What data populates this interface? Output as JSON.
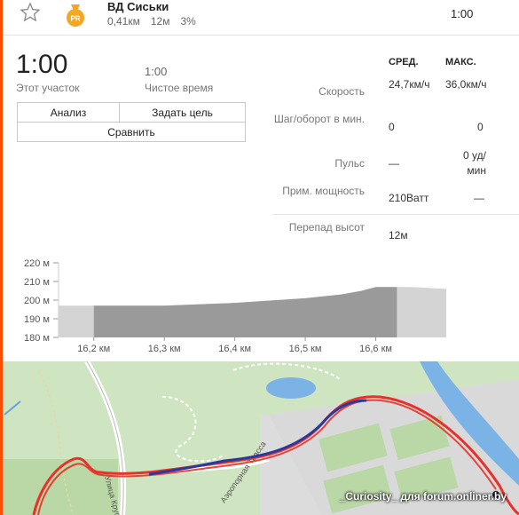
{
  "segment": {
    "name": "ВД Сиськи",
    "distance": "0,41км",
    "elev_gain": "12м",
    "grade": "3%",
    "time": "1:00"
  },
  "summary": {
    "time": "1:00",
    "time_label": "Этот участок",
    "clean_time": "1:00",
    "clean_label": "Чистое время"
  },
  "buttons": {
    "analysis": "Анализ",
    "set_goal": "Задать цель",
    "compare": "Сравнить"
  },
  "stats": {
    "col_avg": "СРЕД.",
    "col_max": "МАКС.",
    "rows": [
      {
        "label": "Скорость",
        "avg": "24,7км/ч",
        "max": "36,0км/ч"
      },
      {
        "label": "Шаг/оборот в мин.",
        "avg": "0",
        "max": "0"
      },
      {
        "label": "Пульс",
        "avg": "—",
        "max": "0 уд/мин"
      },
      {
        "label": "Прим. мощность",
        "avg": "210Ватт",
        "max": "—"
      },
      {
        "label": "Перепад высот",
        "avg": "12м"
      }
    ]
  },
  "chart_data": {
    "type": "area",
    "x": [
      16.15,
      16.2,
      16.3,
      16.4,
      16.5,
      16.55,
      16.58,
      16.6,
      16.65,
      16.7
    ],
    "y": [
      197,
      197,
      197,
      198.5,
      201,
      203,
      205,
      207,
      207,
      206
    ],
    "highlight_range": [
      16.2,
      16.63
    ],
    "xticks": [
      "16,2 км",
      "16,3 км",
      "16,4 км",
      "16,5 км",
      "16,6 км"
    ],
    "yticks": [
      "220 м",
      "210 м",
      "200 м",
      "190 м",
      "180 м"
    ],
    "ylim": [
      180,
      220
    ]
  },
  "map": {
    "credit": "_Curiosity_ для forum.onliner.by",
    "street1": "Улица Крупы",
    "street2": "Аэропорная Трасса"
  },
  "colors": {
    "accent": "#fc4c02",
    "pr_badge": "#f5a623",
    "route_red": "#e8312a",
    "route_blue": "#2a3a9c"
  }
}
